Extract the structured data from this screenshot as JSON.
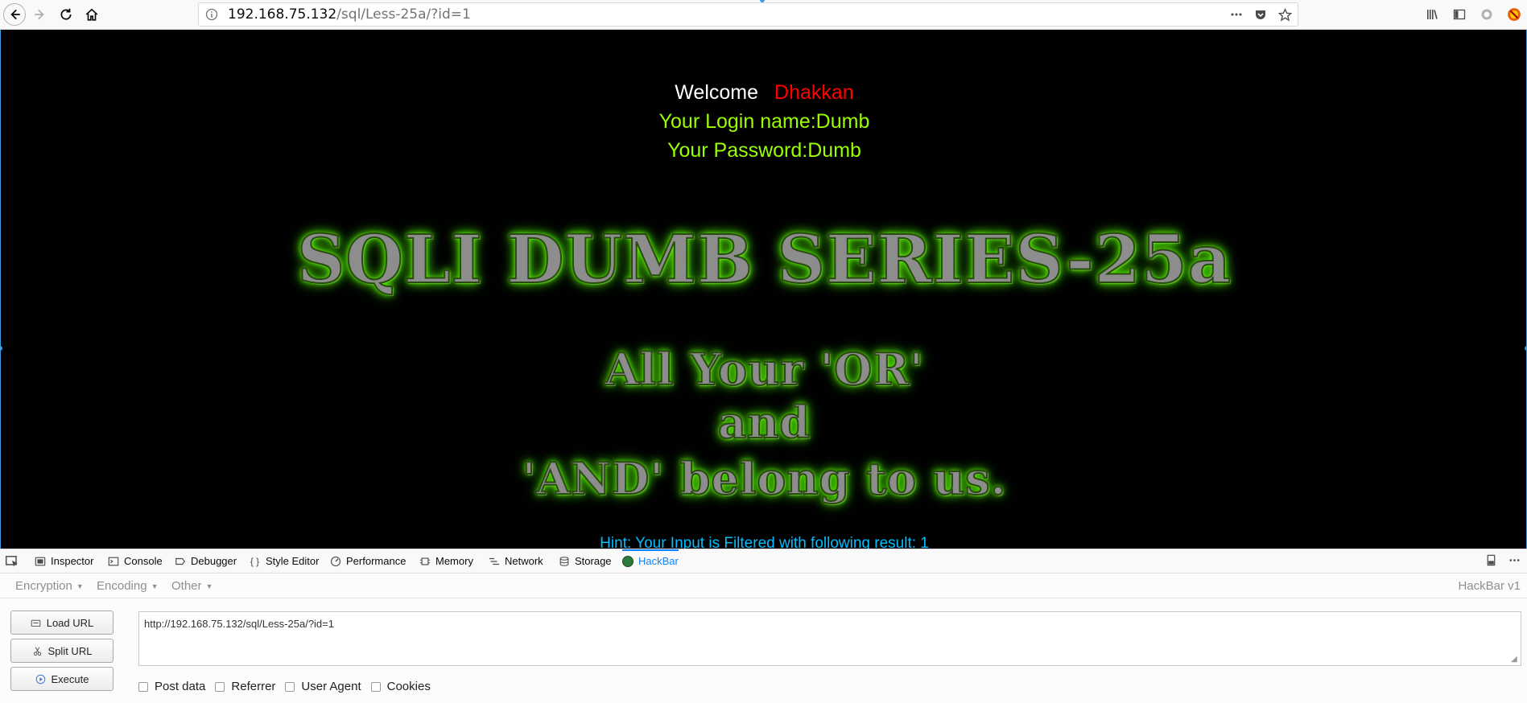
{
  "browser": {
    "url_host": "192.168.75.132",
    "url_path": "/sql/Less-25a/?id=1",
    "icons": [
      "back-icon",
      "forward-icon",
      "reload-icon",
      "home-icon",
      "info-icon",
      "more-icon",
      "pocket-icon",
      "bookmark-star-icon",
      "library-icon",
      "sidebar-icon",
      "account-icon",
      "extension-icon"
    ]
  },
  "page": {
    "welcome_word": "Welcome",
    "welcome_name": "Dhakkan",
    "login_line": "Your Login name:Dumb",
    "password_line": "Your Password:Dumb",
    "title": "SQLI DUMB SERIES-25a",
    "slogan_1": "All Your 'OR'",
    "slogan_2": "and",
    "slogan_3": "'AND' belong to us.",
    "hint": "Hint: Your Input is Filtered with following result: 1",
    "colors": {
      "background": "#000000",
      "welcome": "#ffffff",
      "name": "#ff0000",
      "credentials": "#99ff00",
      "hint": "#00bfff",
      "glow": "#66ff00"
    }
  },
  "devtools": {
    "tabs": [
      {
        "label": "Inspector",
        "icon": "inspector-icon"
      },
      {
        "label": "Console",
        "icon": "console-icon"
      },
      {
        "label": "Debugger",
        "icon": "debugger-icon"
      },
      {
        "label": "Style Editor",
        "icon": "style-editor-icon"
      },
      {
        "label": "Performance",
        "icon": "performance-icon"
      },
      {
        "label": "Memory",
        "icon": "memory-icon"
      },
      {
        "label": "Network",
        "icon": "network-icon"
      },
      {
        "label": "Storage",
        "icon": "storage-icon"
      },
      {
        "label": "HackBar",
        "icon": "hackbar-icon",
        "active": true
      }
    ]
  },
  "hackbar": {
    "menu": {
      "encryption": "Encryption",
      "encoding": "Encoding",
      "other": "Other"
    },
    "version": "HackBar v1",
    "buttons": {
      "load_url": "Load URL",
      "split_url": "Split URL",
      "execute": "Execute"
    },
    "url_value": "http://192.168.75.132/sql/Less-25a/?id=1",
    "checkboxes": {
      "post_data": "Post data",
      "referrer": "Referrer",
      "user_agent": "User Agent",
      "cookies": "Cookies"
    }
  }
}
